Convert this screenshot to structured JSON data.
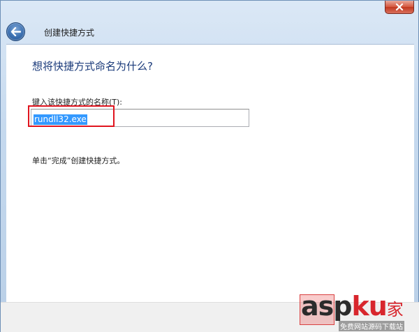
{
  "window": {
    "title": "创建快捷方式"
  },
  "main": {
    "heading": "想将快捷方式命名为什么?",
    "field_label": "键入该快捷方式的名称(T):",
    "name_value": "rundll32.exe",
    "hint": "单击“完成”创建快捷方式。"
  },
  "watermark": {
    "brand_prefix": "asp",
    "brand_k": "ku",
    "brand_cn": "家",
    "subtitle": "免费网站源码下载站"
  },
  "colors": {
    "highlight_border": "#e0141e",
    "selection": "#3399ff",
    "heading": "#1a3a7a"
  },
  "icons": {
    "close": "close-icon",
    "back": "back-arrow-icon"
  }
}
